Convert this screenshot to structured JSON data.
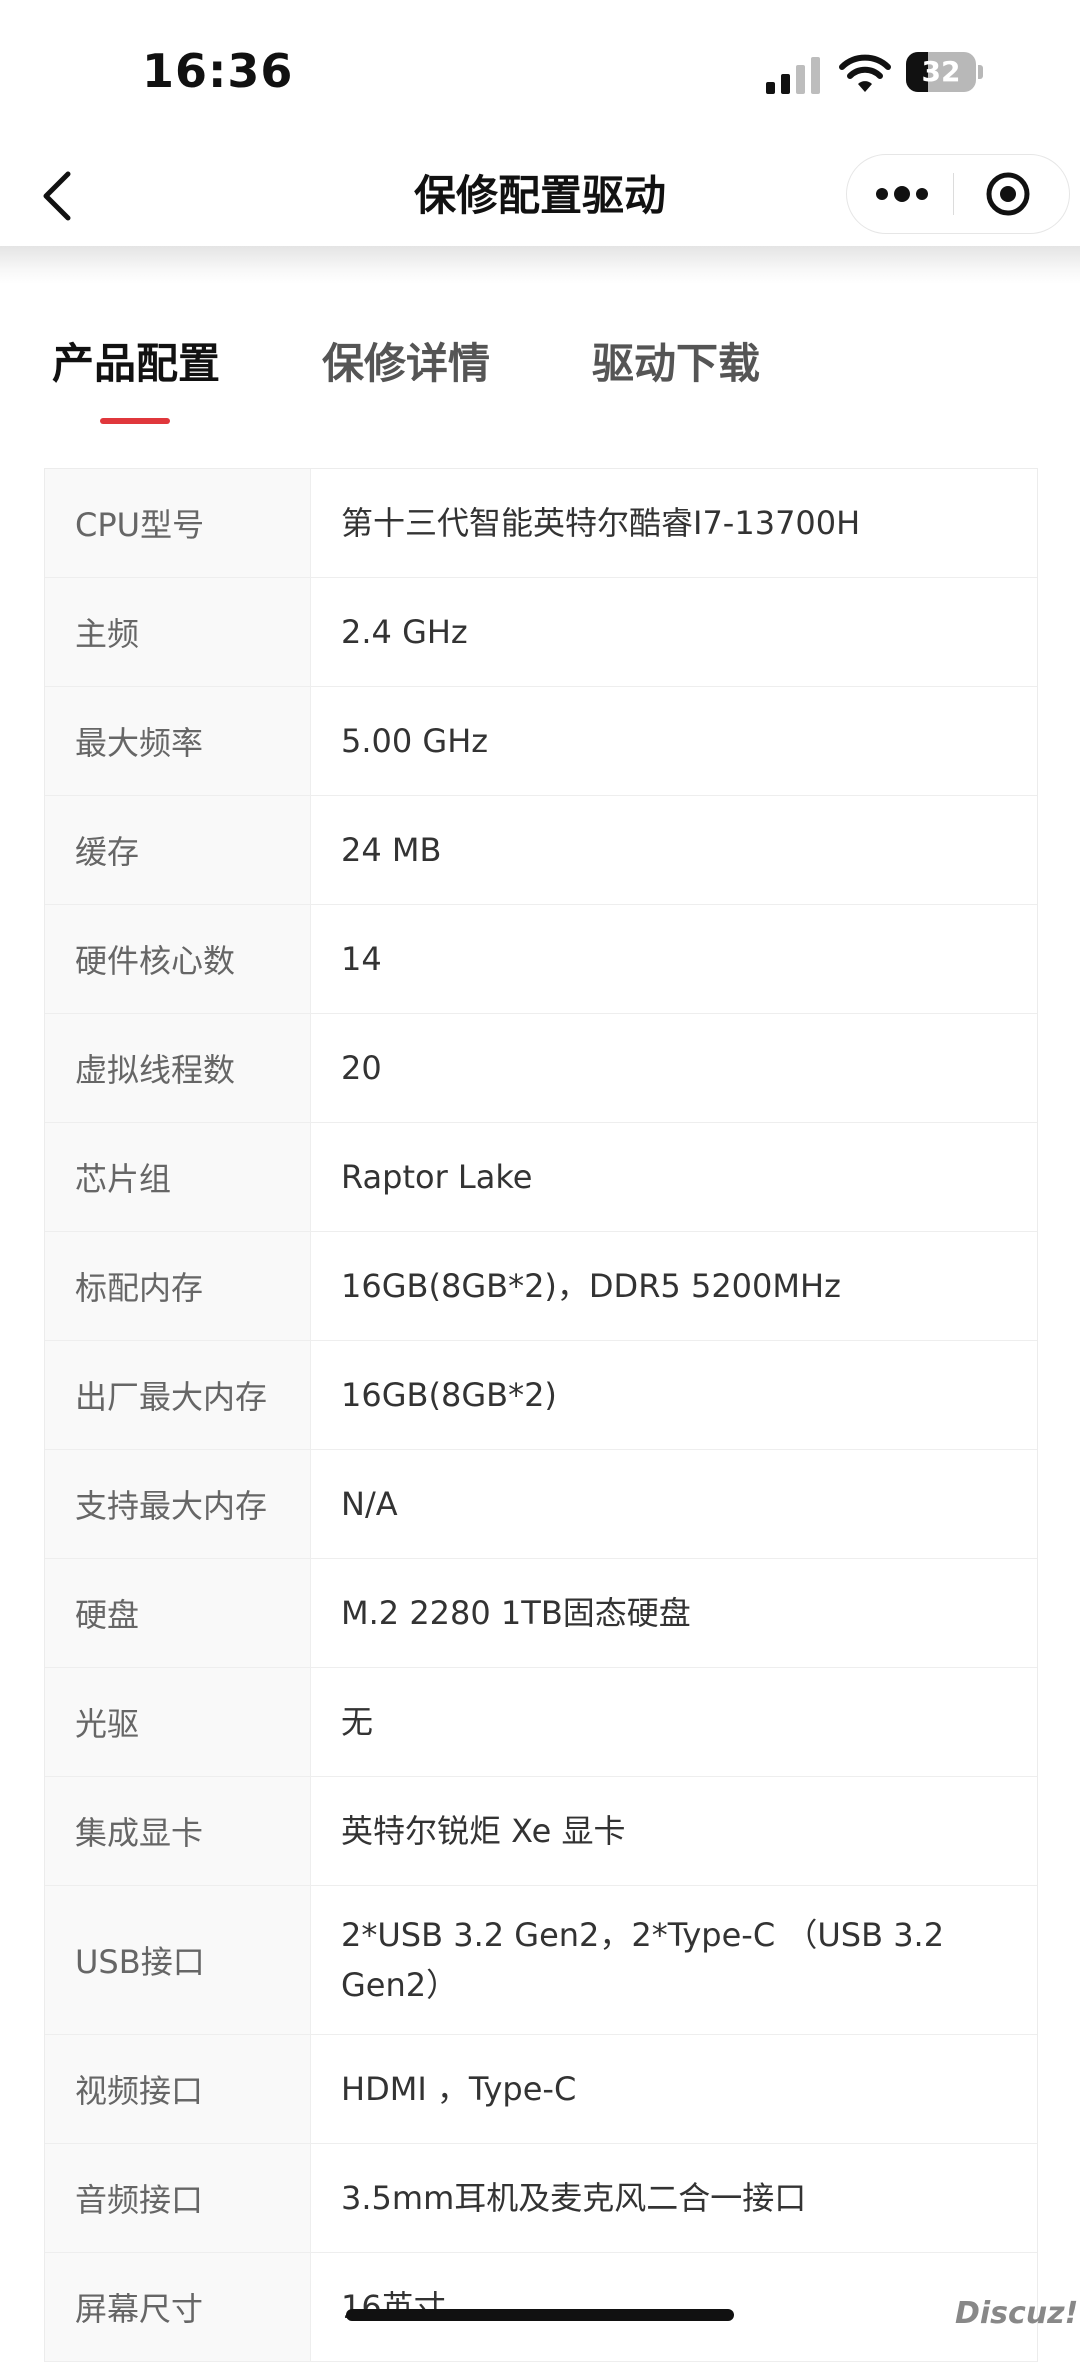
{
  "status_bar": {
    "time": "16:36",
    "battery_level": "32",
    "battery_fraction": 0.32,
    "icons": [
      "signal-icon",
      "wifi-icon",
      "battery-icon"
    ]
  },
  "nav": {
    "title": "保修配置驱动",
    "back_icon": "chevron-left-icon",
    "more_icon": "more-dots-icon",
    "close_icon": "target-close-icon"
  },
  "tabs": [
    {
      "label": "产品配置",
      "active": true
    },
    {
      "label": "保修详情",
      "active": false
    },
    {
      "label": "驱动下载",
      "active": false
    }
  ],
  "specs": [
    {
      "label": "CPU型号",
      "value": "第十三代智能英特尔酷睿I7-13700H"
    },
    {
      "label": "主频",
      "value": "2.4 GHz"
    },
    {
      "label": "最大频率",
      "value": "5.00 GHz"
    },
    {
      "label": "缓存",
      "value": "24 MB"
    },
    {
      "label": "硬件核心数",
      "value": "14"
    },
    {
      "label": "虚拟线程数",
      "value": "20"
    },
    {
      "label": "芯片组",
      "value": "Raptor Lake"
    },
    {
      "label": "标配内存",
      "value": "16GB(8GB*2)，DDR5 5200MHz"
    },
    {
      "label": "出厂最大内存",
      "value": "16GB(8GB*2)"
    },
    {
      "label": "支持最大内存",
      "value": "N/A"
    },
    {
      "label": "硬盘",
      "value": "M.2 2280 1TB固态硬盘"
    },
    {
      "label": "光驱",
      "value": "无"
    },
    {
      "label": "集成显卡",
      "value": "英特尔锐炬 Xe 显卡"
    },
    {
      "label": "USB接口",
      "value": "2*USB 3.2 Gen2，2*Type-C （USB 3.2 Gen2）"
    },
    {
      "label": "视频接口",
      "value": "HDMI ，Type-C"
    },
    {
      "label": "音频接口",
      "value": "3.5mm耳机及麦克风二合一接口"
    },
    {
      "label": "屏幕尺寸",
      "value": "16英寸"
    }
  ],
  "watermark": "Discuz!",
  "colors": {
    "accent": "#e0373c",
    "label_bg": "#f9f9f9"
  }
}
